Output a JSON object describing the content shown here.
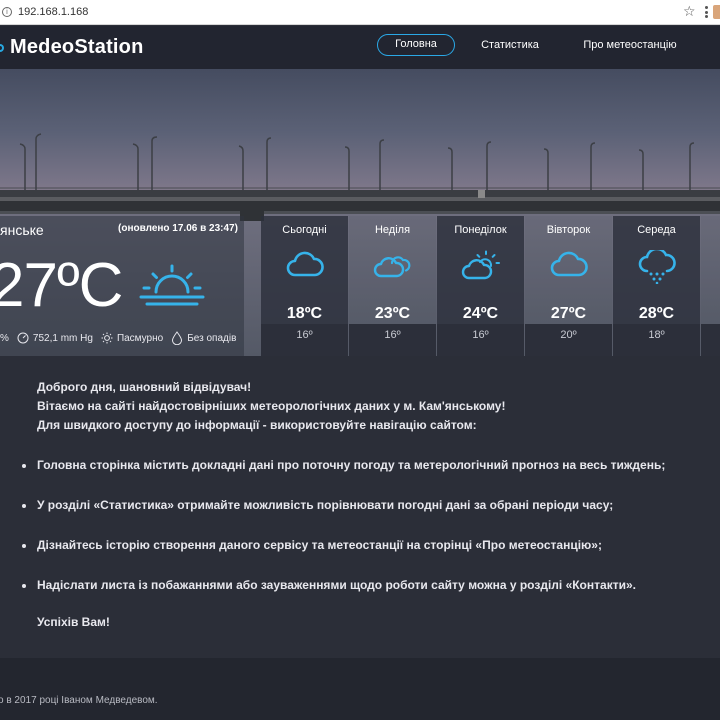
{
  "browser": {
    "url": "192.168.1.168"
  },
  "header": {
    "logo": "MedeoStation",
    "nav": [
      {
        "label": "Головна",
        "active": true
      },
      {
        "label": "Статистика",
        "active": false
      },
      {
        "label": "Про метеостанцію",
        "active": false
      }
    ]
  },
  "current": {
    "city": "янське",
    "updated": "(оновлено 17.06 в 23:47)",
    "temperature": "27ºC",
    "icon": "sunrise-icon",
    "humidity_fragment": "%",
    "pressure": "752,1 mm Hg",
    "condition": "Пасмурно",
    "precipitation": "Без опадів"
  },
  "forecast": [
    {
      "day": "Сьогодні",
      "icon": "cloud-icon",
      "high": "18ºC",
      "low": "16º"
    },
    {
      "day": "Неділя",
      "icon": "clouds-icon",
      "high": "23ºC",
      "low": "16º"
    },
    {
      "day": "Понеділок",
      "icon": "partly-sunny-icon",
      "high": "24ºC",
      "low": "16º"
    },
    {
      "day": "Вівторок",
      "icon": "cloud-icon",
      "high": "27ºC",
      "low": "20º"
    },
    {
      "day": "Середа",
      "icon": "rain-icon",
      "high": "28ºC",
      "low": "18º"
    }
  ],
  "content": {
    "intro": [
      "Доброго дня, шановний відвідувач!",
      "Вітаємо на сайті найдостовірніших метеорологічних даних у м. Кам'янському!",
      "Для швидкого доступу до інформації - використовуйте навігацію сайтом:"
    ],
    "bullets": [
      "Головна сторінка містить докладні дані про поточну погоду та метерологічний прогноз на весь тиждень;",
      "У розділі «Статистика» отримайте можливість порівнювати погодні дані за обрані періоди часу;",
      "Дізнайтесь історію створення даного сервісу та метеостанції на сторінці «Про метеостанцію»;",
      "Надіслати листа із побажаннями або зауваженнями щодо роботи сайту можна у розділі «Контакти»."
    ],
    "farewell": "Успіхів Вам!"
  },
  "footer": {
    "text": "о в 2017 році Іваном Медведевом."
  },
  "colors": {
    "accent": "#2aa8e6",
    "header_bg": "#222530",
    "page_bg": "#2b2e38"
  }
}
